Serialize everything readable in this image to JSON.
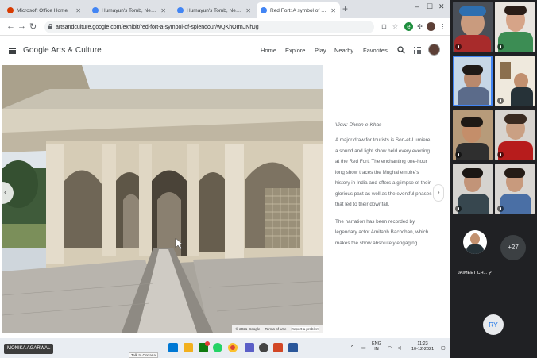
{
  "browser": {
    "tabs": [
      {
        "label": "Microsoft Office Home",
        "favicon_color": "#d83b01"
      },
      {
        "label": "Humayun's Tomb, New Delhi, Ind",
        "favicon_color": "#4285f4"
      },
      {
        "label": "Humayun's Tomb, New Delhi, Ind",
        "favicon_color": "#4285f4"
      },
      {
        "label": "Red Fort: A symbol of splendou",
        "favicon_color": "#4285f4",
        "active": true
      }
    ],
    "new_tab_label": "+",
    "url": "artsandculture.google.com/exhibit/red-fort-a-symbol-of-splendour/wQKhOIrnJNhJg"
  },
  "site": {
    "logo": "Google Arts & Culture",
    "nav": [
      "Home",
      "Explore",
      "Play",
      "Nearby",
      "Favorites"
    ]
  },
  "street_view": {
    "footer": [
      "© 2021 Google",
      "Terms of Use",
      "Report a problem"
    ]
  },
  "story": {
    "caption": "View: Diwan-e-Khas",
    "body": "A major draw for tourists is Son-et-Lumiere, a sound and light show held every evening at the Red Fort. The enchanting one-hour long show traces the Mughal empire's history in India and offers a glimpse of their glorious past as well as the eventful phases that led to their downfall.",
    "narration": "The narration has been recorded by legendary actor Amitabh Bachchan, which makes the show absolutely engaging."
  },
  "taskbar": {
    "presenter_name": "MONIKA AGARWAL",
    "tooltip": "Talk to Cortana",
    "language": "ENG",
    "language_region": "IN",
    "time": "11:23",
    "date": "10-12-2021"
  },
  "meet": {
    "participant_name": "JAIMEET CH...",
    "more_count": "+27",
    "self_initials": "RY"
  },
  "colors": {
    "accent_blue": "#1a73e8",
    "meet_bg": "#202124"
  }
}
